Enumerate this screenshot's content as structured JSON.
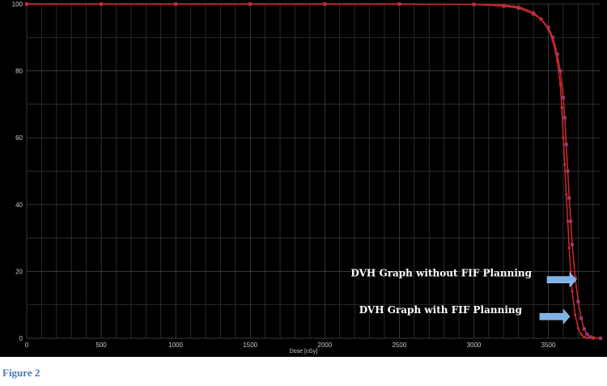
{
  "chart_data": {
    "type": "line",
    "title": "",
    "xlabel": "Dose [cGy]",
    "ylabel": "",
    "xlim": [
      0,
      3850
    ],
    "ylim": [
      0,
      100
    ],
    "xticks": [
      0,
      500,
      1000,
      1500,
      2000,
      2500,
      3000,
      3500
    ],
    "yticks": [
      0,
      20,
      40,
      60,
      80,
      100
    ],
    "grid": true,
    "background": "#000000",
    "grid_color": "#3a3a3a",
    "line_color": "#cc2a2a",
    "series": [
      {
        "x": [
          0,
          500,
          1000,
          1500,
          2000,
          2500,
          3000,
          3200,
          3300,
          3400,
          3450,
          3500,
          3530,
          3560,
          3580,
          3600,
          3610,
          3620,
          3630,
          3640,
          3650,
          3660,
          3680,
          3700,
          3720,
          3740,
          3760,
          3780,
          3800,
          3850
        ],
        "y": [
          100,
          100,
          100,
          100,
          100,
          100,
          99.9,
          99.4,
          98.8,
          97,
          95.5,
          93,
          90,
          85,
          80,
          72,
          66,
          58,
          50,
          42,
          35,
          28,
          18,
          11,
          6,
          2.8,
          1.2,
          0.4,
          0.1,
          0
        ]
      },
      {
        "x": [
          0,
          500,
          1000,
          1500,
          2000,
          2500,
          3000,
          3200,
          3300,
          3400,
          3450,
          3500,
          3530,
          3560,
          3580,
          3590,
          3600,
          3610,
          3620,
          3630,
          3640,
          3650,
          3660,
          3680,
          3700,
          3720,
          3740,
          3760,
          3800
        ],
        "y": [
          100,
          100,
          100,
          100,
          100,
          100,
          99.9,
          99.7,
          99.2,
          97.5,
          95.5,
          92.5,
          89,
          83,
          76,
          69,
          60,
          52,
          43,
          35,
          27,
          20,
          14,
          7,
          3,
          1.2,
          0.4,
          0.1,
          0
        ]
      }
    ],
    "annotations": [
      {
        "text": "DVH Graph without FIF Planning",
        "y": 17.5
      },
      {
        "text": "DVH Graph with FIF Planning",
        "y": 6.5
      }
    ],
    "arrow_color": "#7fb3e8"
  },
  "caption": "Figure 2"
}
